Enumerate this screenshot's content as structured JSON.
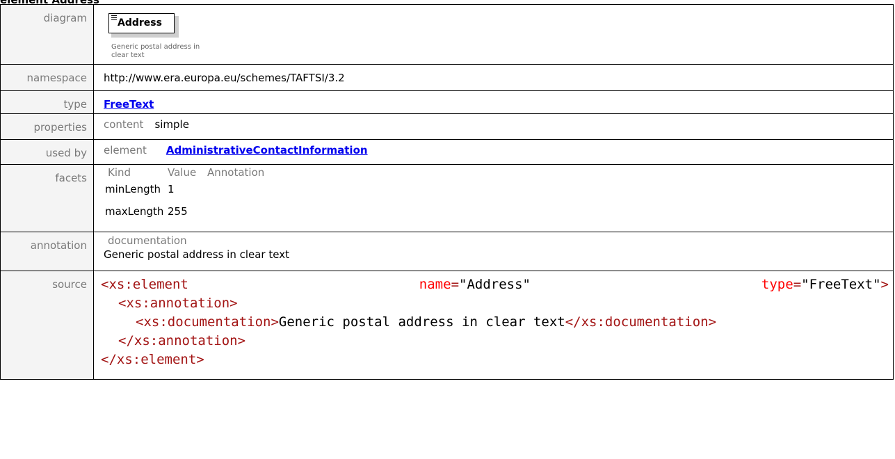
{
  "heading": "element Address",
  "labels": {
    "diagram": "diagram",
    "namespace": "namespace",
    "type": "type",
    "properties": "properties",
    "used_by": "used by",
    "facets": "facets",
    "annotation": "annotation",
    "source": "source"
  },
  "diagram": {
    "box_title": "Address",
    "doc_text": "Generic postal address in clear text"
  },
  "namespace": "http://www.era.europa.eu/schemes/TAFTSI/3.2",
  "type": "FreeText",
  "properties": {
    "label": "content",
    "value": "simple"
  },
  "used_by": {
    "label": "element",
    "value": "AdministrativeContactInformation"
  },
  "facets": {
    "headers": [
      "Kind",
      "Value",
      "Annotation"
    ],
    "rows": [
      {
        "kind": "minLength",
        "value": "1"
      },
      {
        "kind": "maxLength",
        "value": "255"
      }
    ]
  },
  "annotation": {
    "label": "documentation",
    "text": "Generic postal address in clear text"
  },
  "source": {
    "open_tag": "<xs:element",
    "attr_name": "name",
    "attr_name_value": "\"Address\"",
    "attr_type": "type",
    "attr_type_value": "\"FreeText\"",
    "close_bracket": ">",
    "eq": "=",
    "ann_open": "<xs:annotation>",
    "doc_open": "<xs:documentation>",
    "doc_text": "Generic postal address in clear text",
    "doc_close": "</xs:documentation>",
    "ann_close": "</xs:annotation>",
    "el_close": "</xs:element>"
  }
}
